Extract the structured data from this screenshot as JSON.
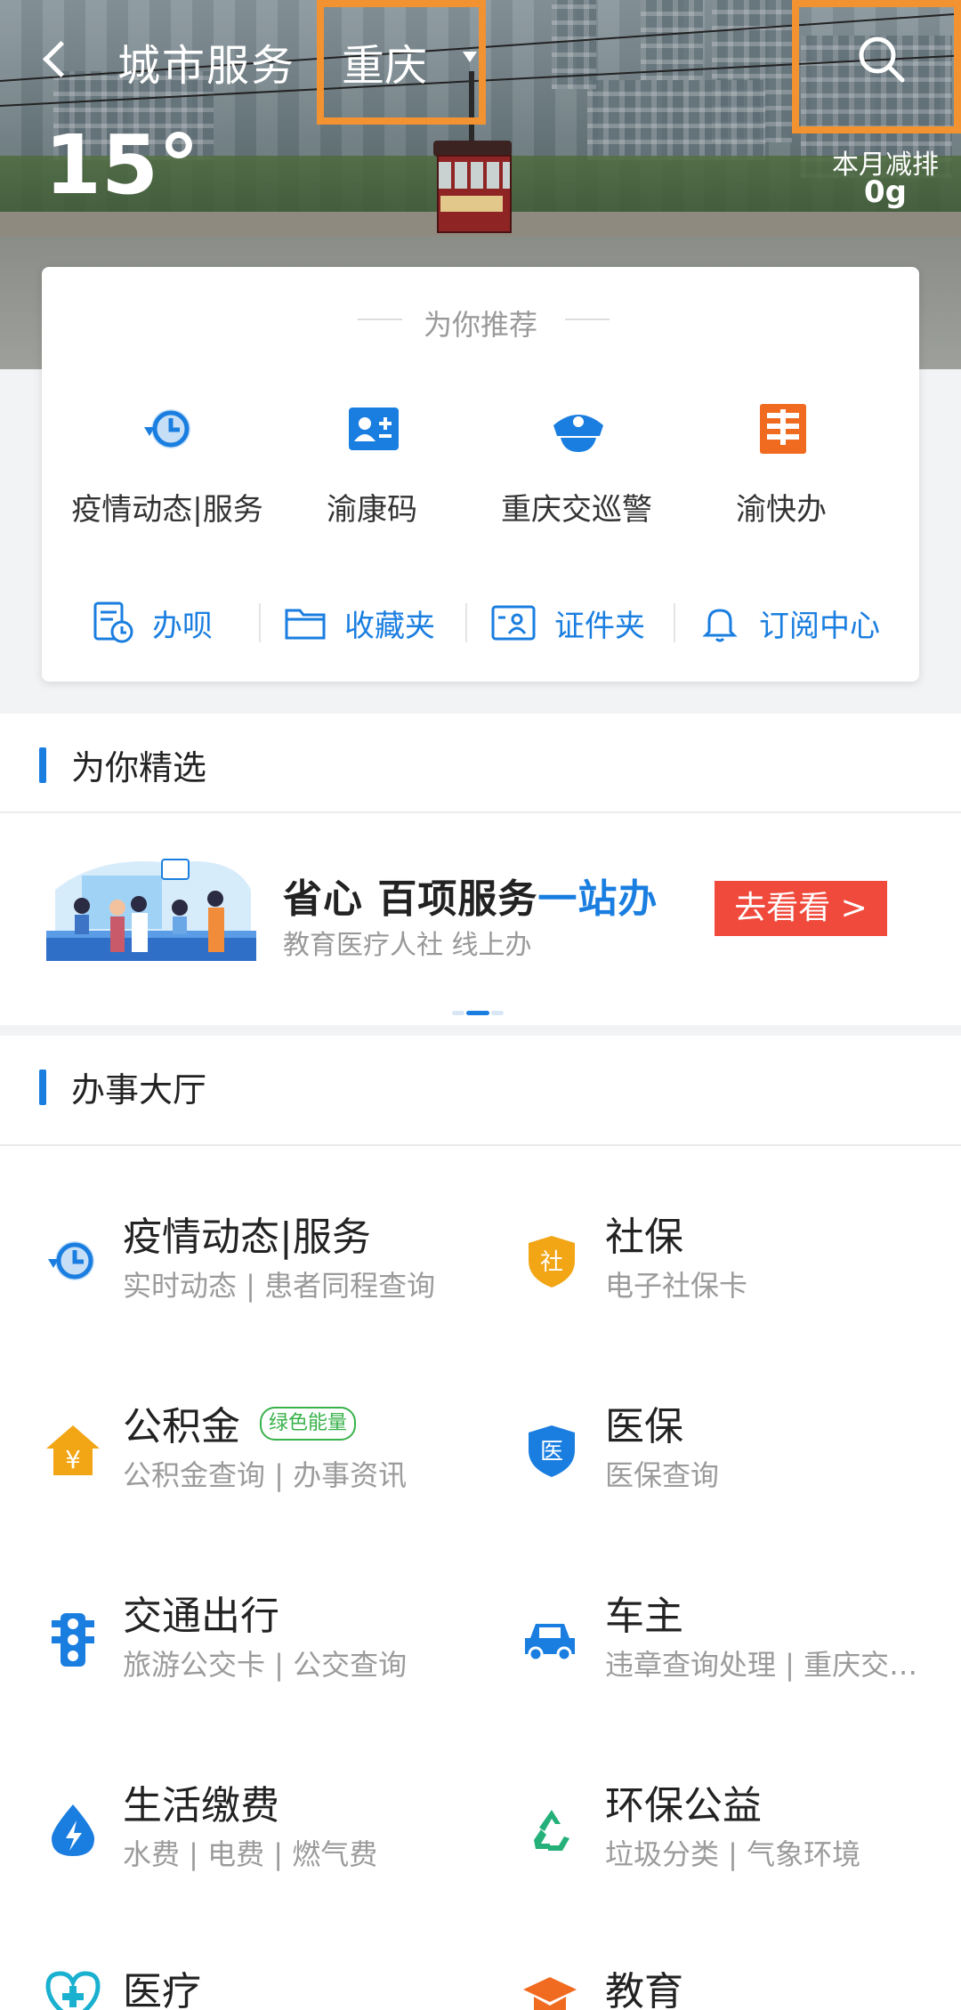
{
  "header": {
    "title": "城市服务",
    "city": "重庆",
    "temperature": "15°",
    "emission_label": "本月减排",
    "emission_value": "0g"
  },
  "recommend": {
    "title": "为你推荐",
    "items": [
      {
        "label": "疫情动态|服务",
        "icon": "clock-history-icon"
      },
      {
        "label": "渝康码",
        "icon": "id-card-icon"
      },
      {
        "label": "重庆交巡警",
        "icon": "police-cap-icon"
      },
      {
        "label": "渝快办",
        "icon": "building-icon"
      }
    ],
    "tools": [
      {
        "label": "办呗",
        "icon": "document-clock-icon"
      },
      {
        "label": "收藏夹",
        "icon": "folder-icon"
      },
      {
        "label": "证件夹",
        "icon": "id-card-outline-icon"
      },
      {
        "label": "订阅中心",
        "icon": "bell-icon"
      }
    ]
  },
  "featured": {
    "section_title": "为你精选",
    "promo_title_part1": "省心 百项服务",
    "promo_title_part2": "一站办",
    "promo_subtitle": "教育医疗人社 线上办",
    "promo_button": "去看看 >"
  },
  "hall": {
    "section_title": "办事大厅",
    "services": [
      {
        "name": "疫情动态|服务",
        "desc": "实时动态 | 患者同程查询",
        "icon": "clock-history-icon",
        "color": "#1a7ee0"
      },
      {
        "name": "社保",
        "desc": "电子社保卡",
        "icon": "shield-icon",
        "color": "#f2a515"
      },
      {
        "name": "公积金",
        "desc": "公积金查询 | 办事资讯",
        "icon": "house-yen-icon",
        "color": "#f2a515",
        "badge": "绿色能量"
      },
      {
        "name": "医保",
        "desc": "医保查询",
        "icon": "medical-shield-icon",
        "color": "#1a7ee0"
      },
      {
        "name": "交通出行",
        "desc": "旅游公交卡 | 公交查询",
        "icon": "traffic-light-icon",
        "color": "#1a7ee0"
      },
      {
        "name": "车主",
        "desc": "违章查询处理 | 重庆交巡警",
        "icon": "car-icon",
        "color": "#1a7ee0"
      },
      {
        "name": "生活缴费",
        "desc": "水费 | 电费 | 燃气费",
        "icon": "water-drop-icon",
        "color": "#1a7ee0"
      },
      {
        "name": "环保公益",
        "desc": "垃圾分类 | 气象环境",
        "icon": "recycle-icon",
        "color": "#25b07a"
      },
      {
        "name": "医疗",
        "desc": "",
        "icon": "heart-plus-icon",
        "color": "#1ab0d0"
      },
      {
        "name": "教育",
        "desc": "",
        "icon": "graduation-cap-icon",
        "color": "#f06b20"
      }
    ]
  },
  "colors": {
    "accent": "#1a7ee0",
    "highlight_box": "#f39230",
    "promo_button": "#f04a3c"
  }
}
